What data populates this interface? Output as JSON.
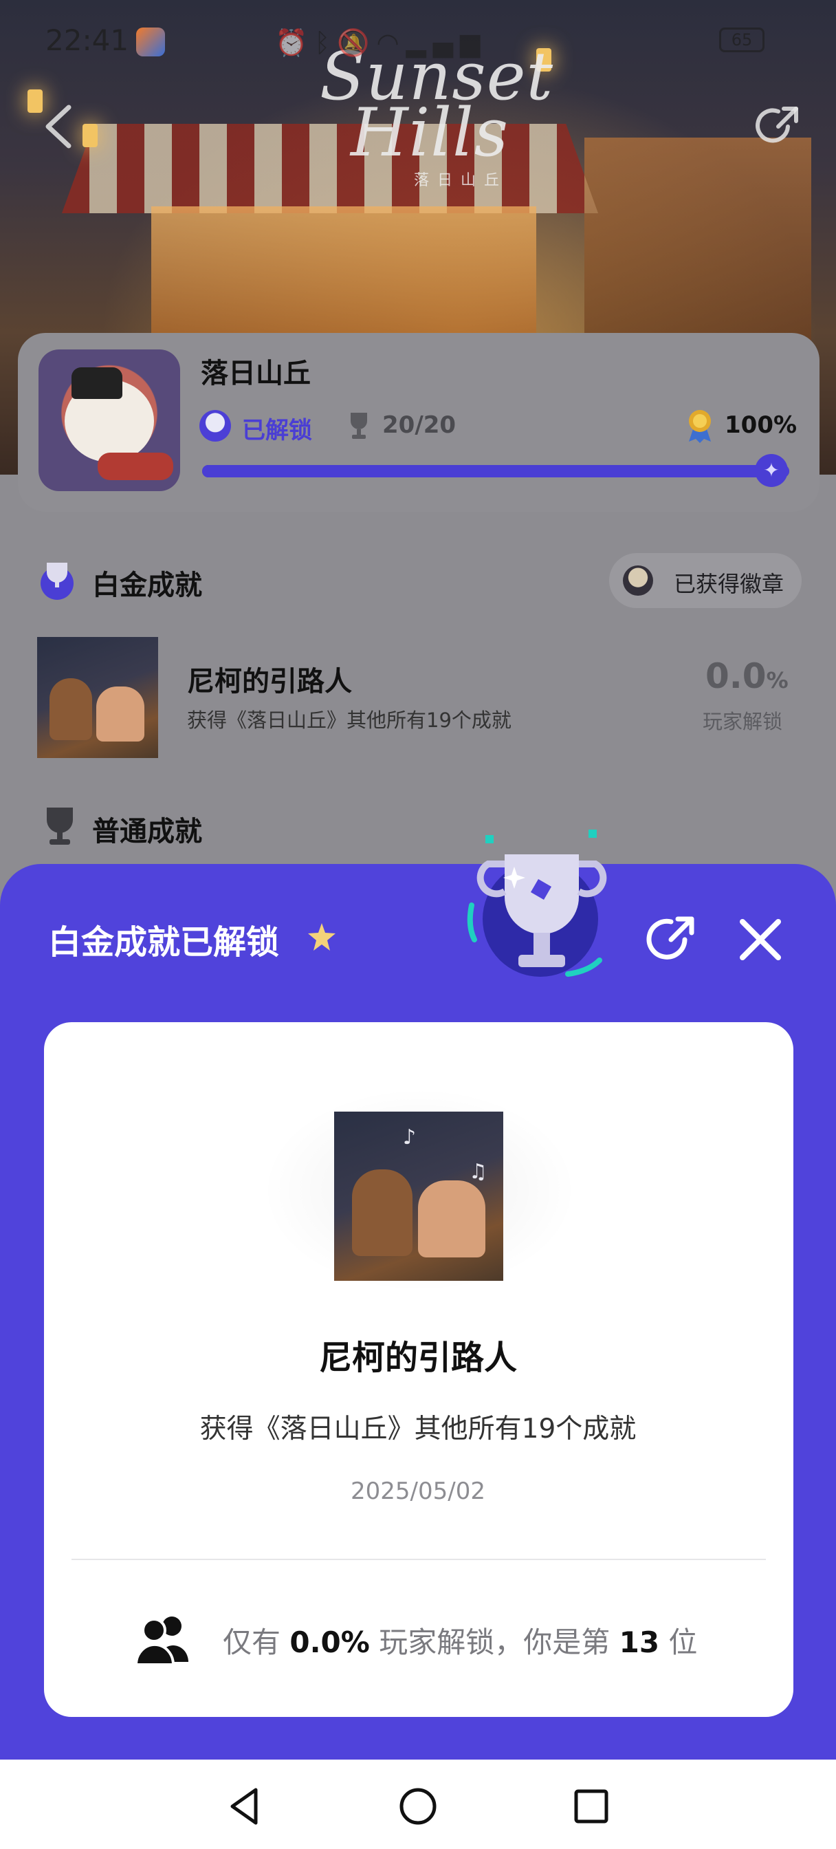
{
  "status_bar": {
    "time": "22:41",
    "battery": "65",
    "icons": [
      "alarm-icon",
      "bluetooth-icon",
      "mute-icon",
      "wifi-icon",
      "signal-icon"
    ]
  },
  "hero": {
    "title_line1": "Sunset",
    "title_line2": "Hills",
    "subtitle": "落日山丘"
  },
  "game": {
    "name": "落日山丘",
    "unlock_label": "已解锁",
    "achievements_count": "20/20",
    "completion_percent": "100%",
    "progress": 1.0
  },
  "platinum_section": {
    "title": "白金成就",
    "badge_button": "已获得徽章"
  },
  "platinum_achievement": {
    "name": "尼柯的引路人",
    "description": "获得《落日山丘》其他所有19个成就",
    "percent_value": "0.0",
    "percent_sign": "%",
    "percent_label": "玩家解锁"
  },
  "normal_section": {
    "title": "普通成就"
  },
  "sheet": {
    "title": "白金成就已解锁",
    "detail": {
      "name": "尼柯的引路人",
      "description": "获得《落日山丘》其他所有19个成就",
      "date": "2025/05/02",
      "rank_prefix": "仅有",
      "rank_percent": "0.0%",
      "rank_middle": "玩家解锁，你是第",
      "rank_number": "13",
      "rank_suffix": "位"
    }
  },
  "colors": {
    "accent": "#5043db",
    "dim_background": "#8d8c91"
  }
}
